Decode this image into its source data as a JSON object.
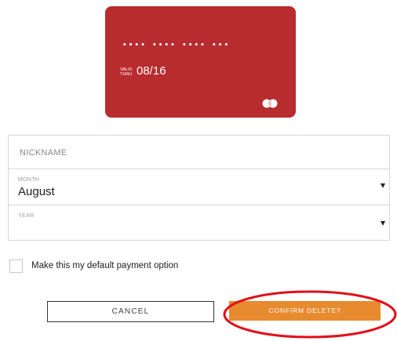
{
  "card": {
    "number_masked": "···· ···· ···· ···",
    "valid_thru_label": "VALID THRU",
    "expiry": "08/16",
    "color": "#b82b2e",
    "brand_icon": "mastercard-icon"
  },
  "form": {
    "nickname": {
      "placeholder": "NICKNAME",
      "value": ""
    },
    "month": {
      "label": "MONTH",
      "value": "August"
    },
    "year": {
      "label": "YEAR",
      "value": ""
    }
  },
  "default_option": {
    "label": "Make this my default payment option",
    "checked": false
  },
  "buttons": {
    "cancel_label": "CANCEL",
    "confirm_label": "CONFIRM DELETE?",
    "confirm_color": "#e88a2e"
  },
  "annotation": {
    "color": "#e0101a",
    "icon": "highlight-ellipse-icon"
  }
}
